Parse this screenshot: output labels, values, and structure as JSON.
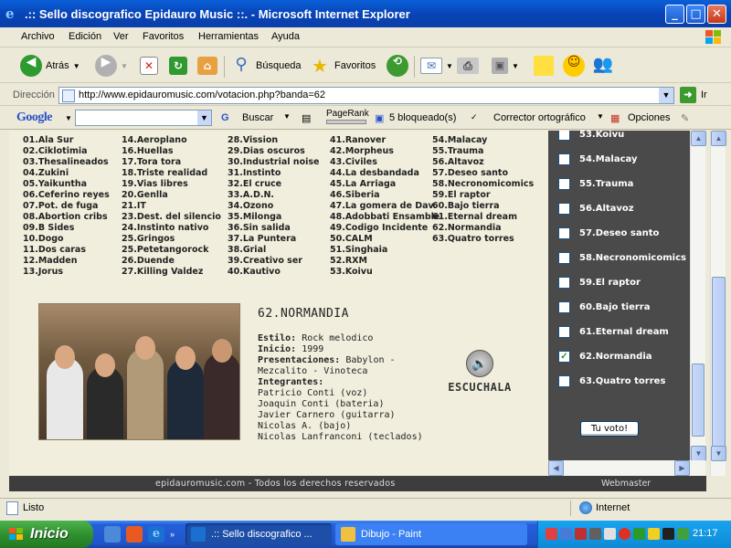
{
  "window": {
    "title": ".:: Sello discografico Epidauro Music ::. - Microsoft Internet Explorer",
    "minimize": "_",
    "maximize": "□",
    "close": "✕"
  },
  "menu": [
    "Archivo",
    "Edición",
    "Ver",
    "Favoritos",
    "Herramientas",
    "Ayuda"
  ],
  "toolbar": {
    "back": "Atrás",
    "search": "Búsqueda",
    "favorites": "Favoritos"
  },
  "address": {
    "label": "Dirección",
    "url": "http://www.epidauromusic.com/votacion.php?banda=62",
    "go": "Ir"
  },
  "googlebar": {
    "logo": "Google",
    "search_button": "Buscar",
    "pagerank": "PageRank",
    "blocked": "5 bloqueado(s)",
    "spell": "Corrector ortográfico",
    "options": "Opciones"
  },
  "bands": [
    [
      "01.Ala Sur",
      "02.Ciklotimia",
      "03.Thesalineados",
      "04.Zukini",
      "05.Yaikuntha",
      "06.Ceferino reyes",
      "07.Pot. de fuga",
      "08.Abortion cribs",
      "09.B Sides",
      "10.Dogo",
      "11.Dos caras",
      "12.Madden",
      "13.Jorus"
    ],
    [
      "14.Aeroplano",
      "16.Huellas",
      "17.Tora tora",
      "18.Triste realidad",
      "19.Vias libres",
      "20.Genlla",
      "21.IT",
      "23.Dest. del silencio",
      "24.Instinto nativo",
      "25.Gringos",
      "25.Petetangorock",
      "26.Duende",
      "27.Killing Valdez"
    ],
    [
      "28.Vission",
      "29.Dias oscuros",
      "30.Industrial noise",
      "31.Instinto",
      "32.El cruce",
      "33.A.D.N.",
      "34.Ozono",
      "35.Milonga",
      "36.Sin salida",
      "37.La Puntera",
      "38.Grial",
      "39.Creativo ser",
      "40.Kautivo"
    ],
    [
      "41.Ranover",
      "42.Morpheus",
      "43.Civiles",
      "44.La desbandada",
      "45.La Arriaga",
      "46.Siberia",
      "47.La gomera de Dav.",
      "48.Adobbati Ensamble",
      "49.Codigo Incidente",
      "50.CALM",
      "51.Singhaia",
      "52.RXM",
      "53.Koivu"
    ],
    [
      "54.Malacay",
      "55.Trauma",
      "56.Altavoz",
      "57.Deseo santo",
      "58.Necronomicomics",
      "59.El raptor",
      "60.Bajo tierra",
      "61.Eternal dream",
      "62.Normandia",
      "63.Quatro torres"
    ]
  ],
  "band_detail": {
    "name": "62.NORMANDIA",
    "style_label": "Estilo:",
    "style": "Rock melodico",
    "start_label": "Inicio:",
    "start": "1999",
    "shows_label": "Presentaciones:",
    "shows_line1": "Babylon -",
    "shows_line2": "Mezcalito - Vinoteca",
    "members_label": "Integrantes:",
    "members": [
      "Patricio Conti (voz)",
      "Joaquin Conti (bateria)",
      "Javier Carnero (guitarra)",
      "Nicolas A. (bajo)",
      "Nicolas Lanfranconi (teclados)"
    ],
    "listen": "ESCUCHALA"
  },
  "vote": {
    "items": [
      {
        "label": "53.Koivu",
        "checked": false
      },
      {
        "label": "54.Malacay",
        "checked": false
      },
      {
        "label": "55.Trauma",
        "checked": false
      },
      {
        "label": "56.Altavoz",
        "checked": false
      },
      {
        "label": "57.Deseo santo",
        "checked": false
      },
      {
        "label": "58.Necronomicomics",
        "checked": false
      },
      {
        "label": "59.El raptor",
        "checked": false
      },
      {
        "label": "60.Bajo tierra",
        "checked": false
      },
      {
        "label": "61.Eternal dream",
        "checked": false
      },
      {
        "label": "62.Normandia",
        "checked": true
      },
      {
        "label": "63.Quatro torres",
        "checked": false
      }
    ],
    "button": "Tu voto!"
  },
  "footer": {
    "text": "epidauromusic.com - Todos los derechos reservados",
    "webmaster": "Webmaster"
  },
  "status": {
    "text": "Listo",
    "zone": "Internet"
  },
  "taskbar": {
    "start": "Inicio",
    "tasks": [
      ".:: Sello discografico ...",
      "Dibujo - Paint"
    ],
    "clock": "21:17"
  }
}
